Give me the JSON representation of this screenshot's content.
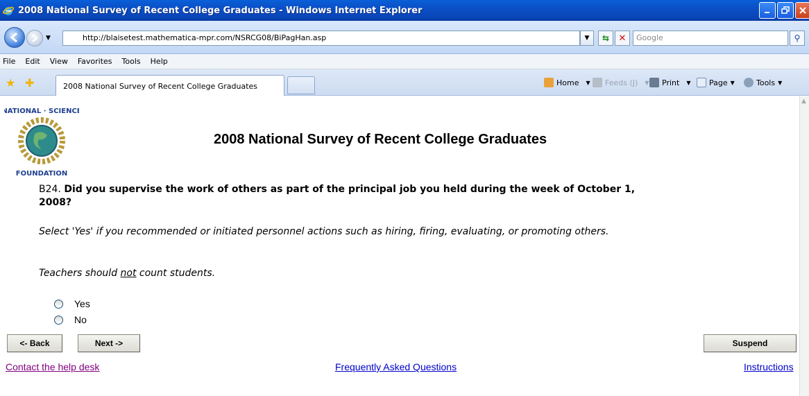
{
  "window": {
    "title": "2008 National Survey of Recent College Graduates - Windows Internet Explorer"
  },
  "addressbar": {
    "url": "http://blaisetest.mathematica-mpr.com/NSRCG08/BiPagHan.asp",
    "search_placeholder": "Google"
  },
  "menu": {
    "items": [
      "File",
      "Edit",
      "View",
      "Favorites",
      "Tools",
      "Help"
    ]
  },
  "tabs": {
    "active_label": "2008 National Survey of Recent College Graduates"
  },
  "commands": {
    "home": "Home",
    "feeds": "Feeds (J)",
    "print": "Print",
    "page": "Page",
    "tools": "Tools"
  },
  "page": {
    "logo_text_top": "NATIONAL · SCIENCE",
    "logo_text_bottom": "FOUNDATION",
    "title": "2008 National Survey of Recent College Graduates",
    "question_number": "B24.",
    "question_text": "Did you supervise the work of others as part of the principal job you held during the week of October 1, 2008?",
    "note1": "Select 'Yes' if you recommended or initiated personnel actions such as hiring, firing, evaluating, or promoting others.",
    "note2_before": "Teachers should ",
    "note2_underlined": "not",
    "note2_after": " count students.",
    "options": [
      "Yes",
      "No"
    ],
    "buttons": {
      "back": "<- Back",
      "next": "Next ->",
      "suspend": "Suspend"
    },
    "links": {
      "help": "Contact the help desk",
      "faq": "Frequently Asked Questions",
      "instructions": "Instructions"
    }
  }
}
